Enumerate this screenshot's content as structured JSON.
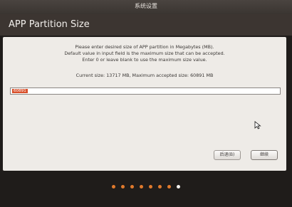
{
  "window": {
    "title": "系统设置"
  },
  "header": {
    "title": "APP Partition Size"
  },
  "info": {
    "lines": [
      "Please enter desired size of APP partition in Megabytes (MB).",
      "Default value in input field is the maximum size that can be accepted.",
      "Enter 0 or leave blank to use the maximum size value."
    ],
    "current": "Current size: 13717 MB, Maximum accepted size: 60891 MB"
  },
  "input": {
    "value": "60891"
  },
  "buttons": {
    "back_label": "后退(B)",
    "next_label": "继续"
  },
  "progress": {
    "total_steps": 8,
    "current_step": 8
  },
  "colors": {
    "accent": "#e07a2d",
    "selection": "#d9502b",
    "header_bg": "#3c3531",
    "panel_bg": "#eeebe7"
  }
}
